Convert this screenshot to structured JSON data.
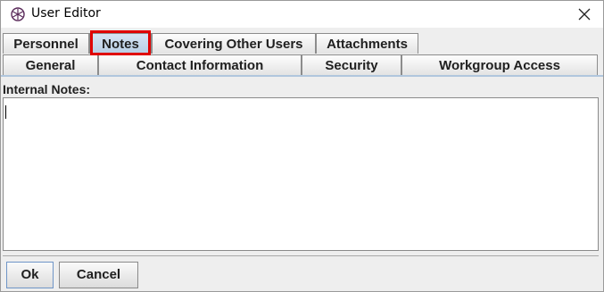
{
  "window": {
    "title": "User Editor",
    "app_icon": "app-logo-icon",
    "close_icon": "close-icon"
  },
  "tabs": {
    "row_top": [
      {
        "label": "Personnel",
        "selected": false
      },
      {
        "label": "Notes",
        "selected": true
      },
      {
        "label": "Covering Other Users",
        "selected": false
      },
      {
        "label": "Attachments",
        "selected": false
      }
    ],
    "row_bottom": [
      {
        "label": "General"
      },
      {
        "label": "Contact Information"
      },
      {
        "label": "Security"
      },
      {
        "label": "Workgroup Access"
      }
    ]
  },
  "notes": {
    "label": "Internal Notes:",
    "value": ""
  },
  "buttons": {
    "ok": "Ok",
    "cancel": "Cancel"
  },
  "colors": {
    "selected_tab": "#c4d6ea",
    "highlight": "#e00000"
  }
}
